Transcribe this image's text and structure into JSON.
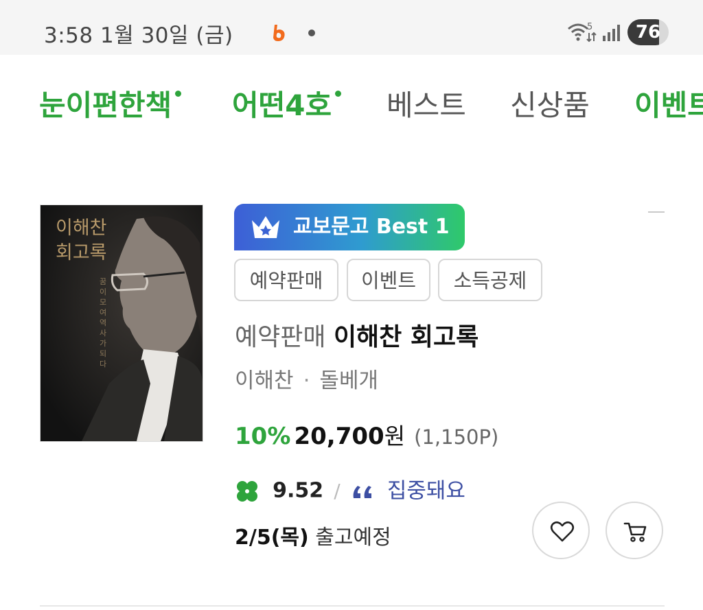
{
  "status_bar": {
    "time": "3:58  1월 30일 (금)",
    "battery": "76",
    "app_icon": "b-orange-app-icon",
    "wifi_icon": "wifi-icon",
    "signal_icon": "signal-icon"
  },
  "tabs": [
    {
      "label": "눈이편한책",
      "color": "green",
      "new": true
    },
    {
      "label": "어떤4호",
      "color": "green",
      "new": true
    },
    {
      "label": "베스트",
      "color": "gray",
      "new": false
    },
    {
      "label": "신상품",
      "color": "gray",
      "new": false
    },
    {
      "label": "이벤트",
      "color": "green",
      "new": false
    }
  ],
  "product": {
    "cover": {
      "title_line1": "이해찬",
      "title_line2": "회고록",
      "subtitle": "꿈이모여역사가되다"
    },
    "badge": "교보문고 Best 1",
    "tags": [
      "예약판매",
      "이벤트",
      "소득공제"
    ],
    "title_prefix": "예약판매",
    "title": "이해찬 회고록",
    "author": "이해찬",
    "publisher": "돌베개",
    "discount": "10%",
    "price": "20,700",
    "currency": "원",
    "points": "(1,150P)",
    "rating": "9.52",
    "review_keyword": "집중돼요",
    "ship_date": "2/5(목)",
    "ship_text": "출고예정"
  },
  "colors": {
    "accent_green": "#2ea43c",
    "review_blue": "#3d4fa3"
  }
}
